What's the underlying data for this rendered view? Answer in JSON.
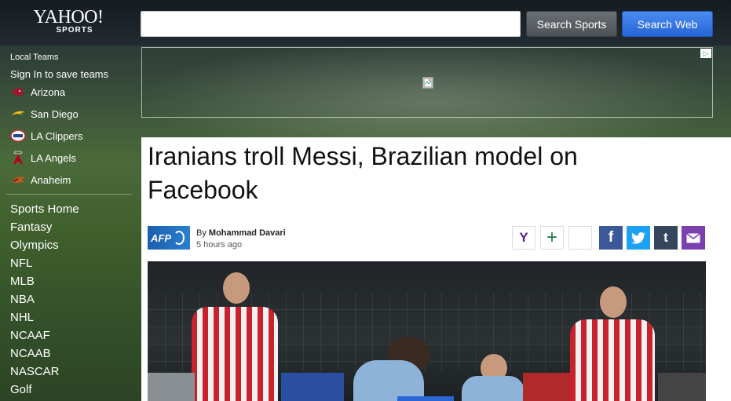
{
  "header": {
    "logo_main": "YAHOO!",
    "logo_sub": "SPORTS",
    "search": {
      "value": "",
      "placeholder": ""
    },
    "search_sports_label": "Search Sports",
    "search_web_label": "Search Web"
  },
  "sidebar": {
    "local_heading": "Local Teams",
    "signin_text": "Sign In to save teams",
    "teams": [
      {
        "label": "Arizona",
        "icon": "cardinals-logo-icon",
        "color": "#a3152b"
      },
      {
        "label": "San Diego",
        "icon": "chargers-bolt-icon",
        "color": "#f0c21b"
      },
      {
        "label": "LA Clippers",
        "icon": "clippers-logo-icon",
        "color": "#d2283a"
      },
      {
        "label": "LA Angels",
        "icon": "angels-logo-icon",
        "color": "#ba0021"
      },
      {
        "label": "Anaheim",
        "icon": "ducks-logo-icon",
        "color": "#c7561c"
      }
    ],
    "nav": [
      "Sports Home",
      "Fantasy",
      "Olympics",
      "NFL",
      "MLB",
      "NBA",
      "NHL",
      "NCAAF",
      "NCAAB",
      "NASCAR",
      "Golf"
    ]
  },
  "article": {
    "headline": "Iranians troll Messi, Brazilian model on Facebook",
    "source_logo": "AFP",
    "byline_prefix": "By",
    "author": "Mohammad Davari",
    "time": "5 hours ago",
    "share": [
      {
        "icon": "yahoo-y-icon",
        "glyph": "Y",
        "bg": "#ffffff",
        "fg": "#5f1aa0"
      },
      {
        "icon": "plus-icon",
        "glyph": "+",
        "bg": "#ffffff",
        "fg": "#1a7a4a"
      },
      {
        "icon": "blank-share-icon",
        "glyph": "",
        "bg": "#ffffff",
        "fg": "#888888"
      },
      {
        "icon": "facebook-icon",
        "glyph": "f",
        "bg": "#3b5998",
        "fg": "#ffffff"
      },
      {
        "icon": "twitter-icon",
        "glyph": "🐦",
        "bg": "#1da1f2",
        "fg": "#ffffff"
      },
      {
        "icon": "tumblr-icon",
        "glyph": "t",
        "bg": "#35465c",
        "fg": "#ffffff"
      },
      {
        "icon": "email-icon",
        "glyph": "✉",
        "bg": "#7b3fb0",
        "fg": "#ffffff"
      }
    ]
  }
}
